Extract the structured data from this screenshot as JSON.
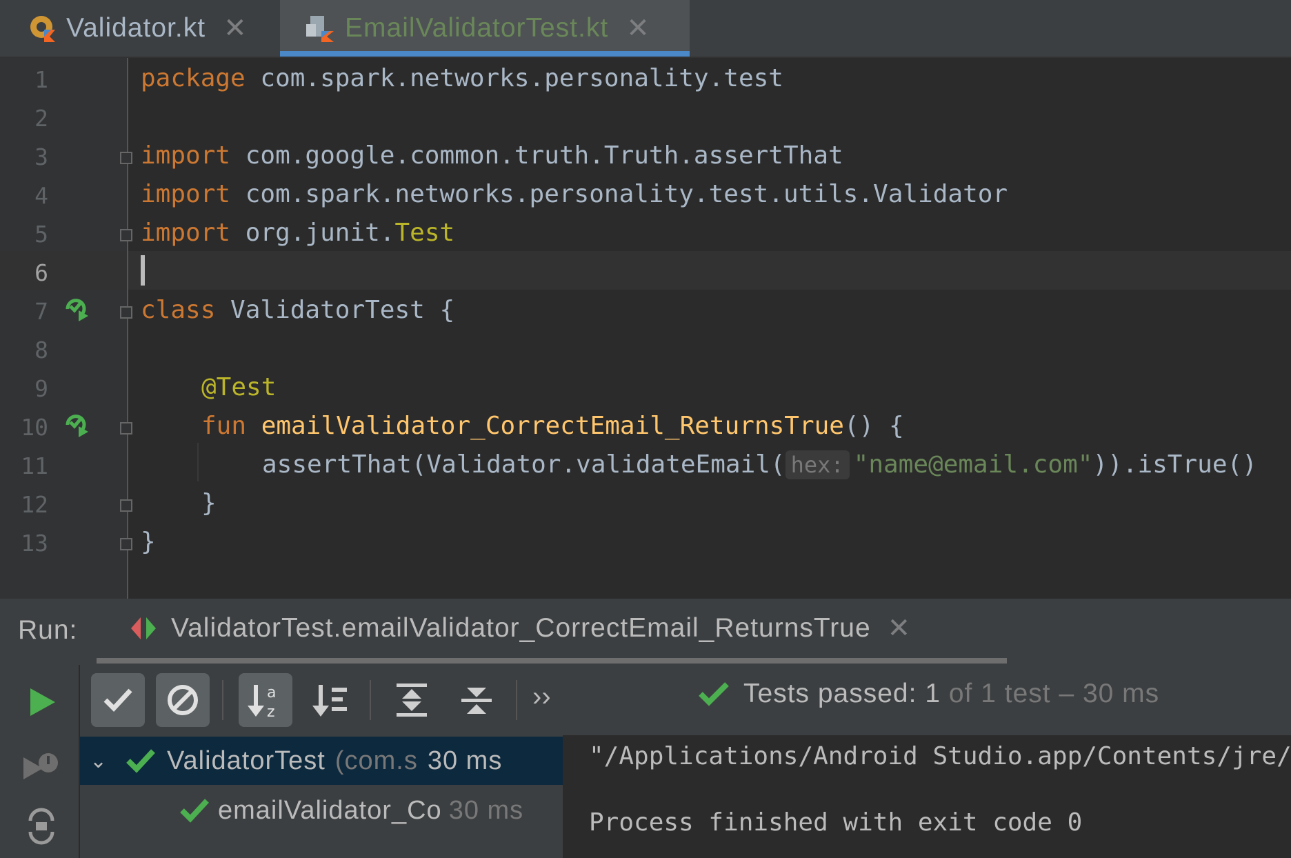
{
  "tabs": [
    {
      "label": "Validator.kt",
      "active": false,
      "icon": "kotlin-class-icon"
    },
    {
      "label": "EmailValidatorTest.kt",
      "active": true,
      "icon": "kotlin-file-icon"
    }
  ],
  "editor": {
    "line_numbers": [
      "1",
      "2",
      "3",
      "4",
      "5",
      "6",
      "7",
      "8",
      "9",
      "10",
      "11",
      "12",
      "13"
    ],
    "line1": {
      "kw": "package",
      "rest": " com.spark.networks.personality.test"
    },
    "line3": {
      "kw": "import",
      "rest": " com.google.common.truth.Truth.assertThat"
    },
    "line4": {
      "kw": "import",
      "rest": " com.spark.networks.personality.test.utils.Validator"
    },
    "line5": {
      "kw": "import",
      "rest": " org.junit.",
      "ann": "Test"
    },
    "line7": {
      "kw": "class",
      "rest": " ValidatorTest {"
    },
    "line9": {
      "ann": "@Test"
    },
    "line10": {
      "kw": "fun",
      "fn": " emailValidator_CorrectEmail_ReturnsTrue",
      "rest": "() {"
    },
    "line11": {
      "pre": "assertThat(Validator.validateEmail(",
      "hint": "hex:",
      "str": "\"name@email.com\"",
      "post": ")).isTrue()"
    },
    "line12": {
      "text": "}"
    },
    "line13": {
      "text": "}"
    }
  },
  "run": {
    "label": "Run:",
    "tab_title": "ValidatorTest.emailValidator_CorrectEmail_ReturnsTrue",
    "status_prefix": "Tests passed:",
    "status_count": "1",
    "status_rest": "of 1 test – 30 ms",
    "more": "››"
  },
  "tree": [
    {
      "name": "ValidatorTest",
      "pkg": "(com.s",
      "time": "30 ms"
    },
    {
      "name": "emailValidator_Co",
      "time": "30 ms"
    }
  ],
  "console": {
    "line1": "\"/Applications/Android Studio.app/Contents/jre/",
    "line2": "Process finished with exit code 0"
  },
  "colors": {
    "keyword": "#cc7832",
    "annotation": "#bbb529",
    "function": "#ffc66d",
    "string": "#6a8759",
    "pass_green": "#4caf50",
    "accent": "#4a88c7"
  }
}
